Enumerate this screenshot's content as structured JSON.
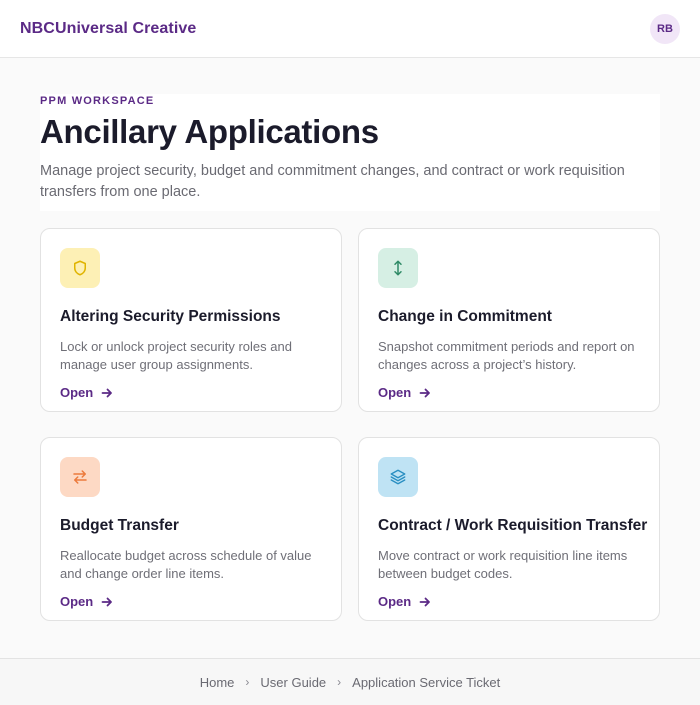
{
  "header": {
    "brand": "NBCUniversal Creative",
    "avatar_initials": "RB"
  },
  "intro": {
    "eyebrow": "PPM WORKSPACE",
    "title": "Ancillary Applications",
    "subtitle": "Manage project security, budget and commitment changes, and contract or work requisition transfers from one place."
  },
  "cards": [
    {
      "title": "Altering Security Permissions",
      "description": "Lock or unlock project security roles and manage user group assignments.",
      "link_label": "Open",
      "icon": "shield-icon",
      "icon_bg": "#fdf0b5",
      "icon_color": "#e0b400"
    },
    {
      "title": "Change in Commitment",
      "description": "Snapshot commitment periods and report on changes across a project’s history.",
      "link_label": "Open",
      "icon": "arrows-vertical-icon",
      "icon_bg": "#d6efe4",
      "icon_color": "#2f8a66"
    },
    {
      "title": "Budget Transfer",
      "description": "Reallocate budget across schedule of value and change order line items.",
      "link_label": "Open",
      "icon": "swap-horizontal-icon",
      "icon_bg": "#fdd9c4",
      "icon_color": "#ec7a3c"
    },
    {
      "title": "Contract / Work Requisition Transfer",
      "description": "Move contract or work requisition line items between budget codes.",
      "link_label": "Open",
      "icon": "layers-icon",
      "icon_bg": "#bfe3f4",
      "icon_color": "#2a8fc2"
    }
  ],
  "footer": {
    "links": [
      "Home",
      "User Guide",
      "Application Service Ticket"
    ],
    "separator": "›"
  },
  "colors": {
    "brand": "#5b2a86",
    "background": "#fafafa"
  }
}
